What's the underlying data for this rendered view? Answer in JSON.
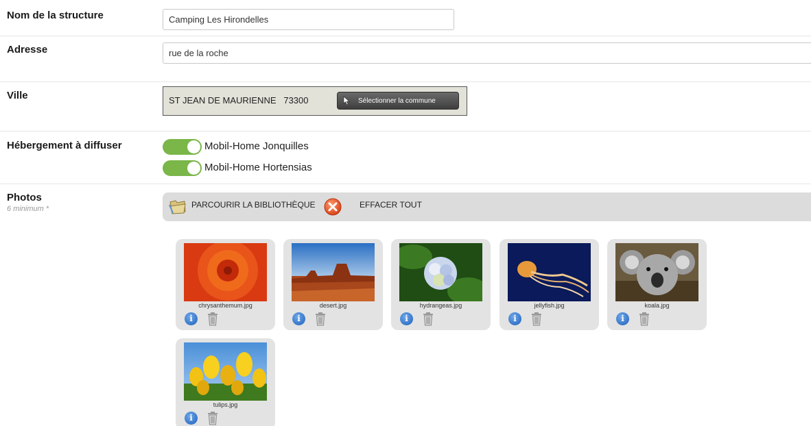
{
  "form": {
    "nom": {
      "label": "Nom de la structure",
      "value": "Camping Les Hirondelles"
    },
    "adresse": {
      "label": "Adresse",
      "value": "rue de la roche"
    },
    "ville": {
      "label": "Ville",
      "value": "ST JEAN DE MAURIENNE   73300",
      "button": "Sélectionner la commune"
    },
    "hebergement": {
      "label": "Hébergement à diffuser",
      "items": [
        {
          "label": "Mobil-Home Jonquilles",
          "checked": true
        },
        {
          "label": "Mobil-Home Hortensias",
          "checked": true
        }
      ]
    },
    "photos": {
      "label": "Photos",
      "sublabel": "6 minimum *",
      "browse_label": "PARCOURIR LA BIBLIOTHÈQUE",
      "clear_label": "EFFACER TOUT",
      "items": [
        {
          "filename": "chrysanthemum.jpg"
        },
        {
          "filename": "desert.jpg"
        },
        {
          "filename": "hydrangeas.jpg"
        },
        {
          "filename": "jellyfish.jpg"
        },
        {
          "filename": "koala.jpg"
        },
        {
          "filename": "tulips.jpg"
        }
      ]
    }
  },
  "colors": {
    "toggle_on": "#7ab648",
    "toolbar_bg": "#dcdcdc",
    "card_bg": "#e3e3e3",
    "ville_bg": "#e3e2d9"
  },
  "icons": [
    "folder-open-icon",
    "delete-circle-icon",
    "cursor-arrow-icon",
    "info-icon",
    "trash-icon"
  ]
}
